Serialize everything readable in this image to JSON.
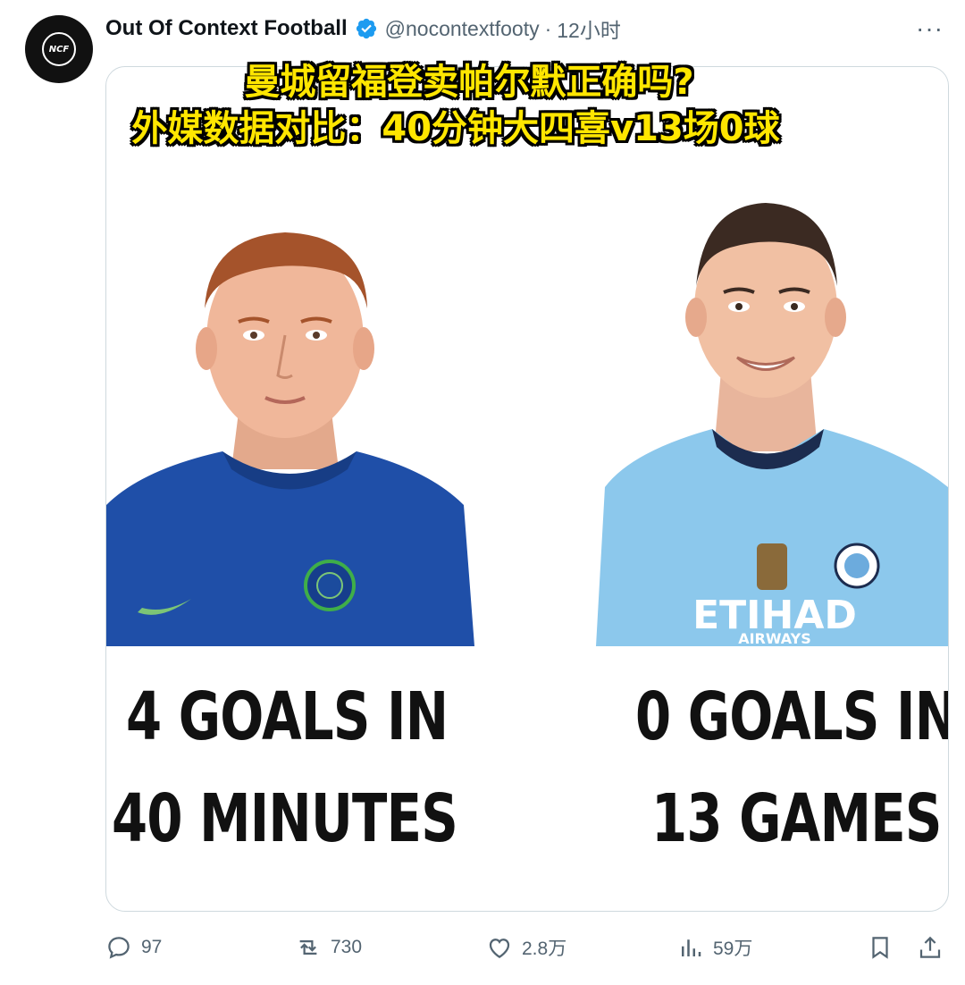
{
  "tweet": {
    "display_name": "Out Of Context Football",
    "handle": "@nocontextfooty",
    "separator": "·",
    "time": "12小时",
    "more_label": "···",
    "avatar_text": "NCF"
  },
  "overlay_caption": {
    "line1": "曼城留福登卖帕尔默正确吗?",
    "line2": "外媒数据对比：40分钟大四喜v13场0球"
  },
  "image": {
    "left_stat_line1": "4 GOALS IN",
    "left_stat_line2": "40 MINUTES",
    "right_stat_line1": "0 GOALS IN",
    "right_stat_line2": "13 GAMES",
    "right_jersey_sponsor": "ETIHAD",
    "right_jersey_sponsor_sub": "AIRWAYS",
    "colors": {
      "left_jersey": "#1f4fa8",
      "right_jersey": "#8cc8ec"
    }
  },
  "actions": {
    "replies": "97",
    "reposts": "730",
    "likes": "2.8万",
    "views": "59万"
  },
  "colors": {
    "verified": "#1d9bf0",
    "muted": "#536471",
    "caption": "#ffe600"
  }
}
